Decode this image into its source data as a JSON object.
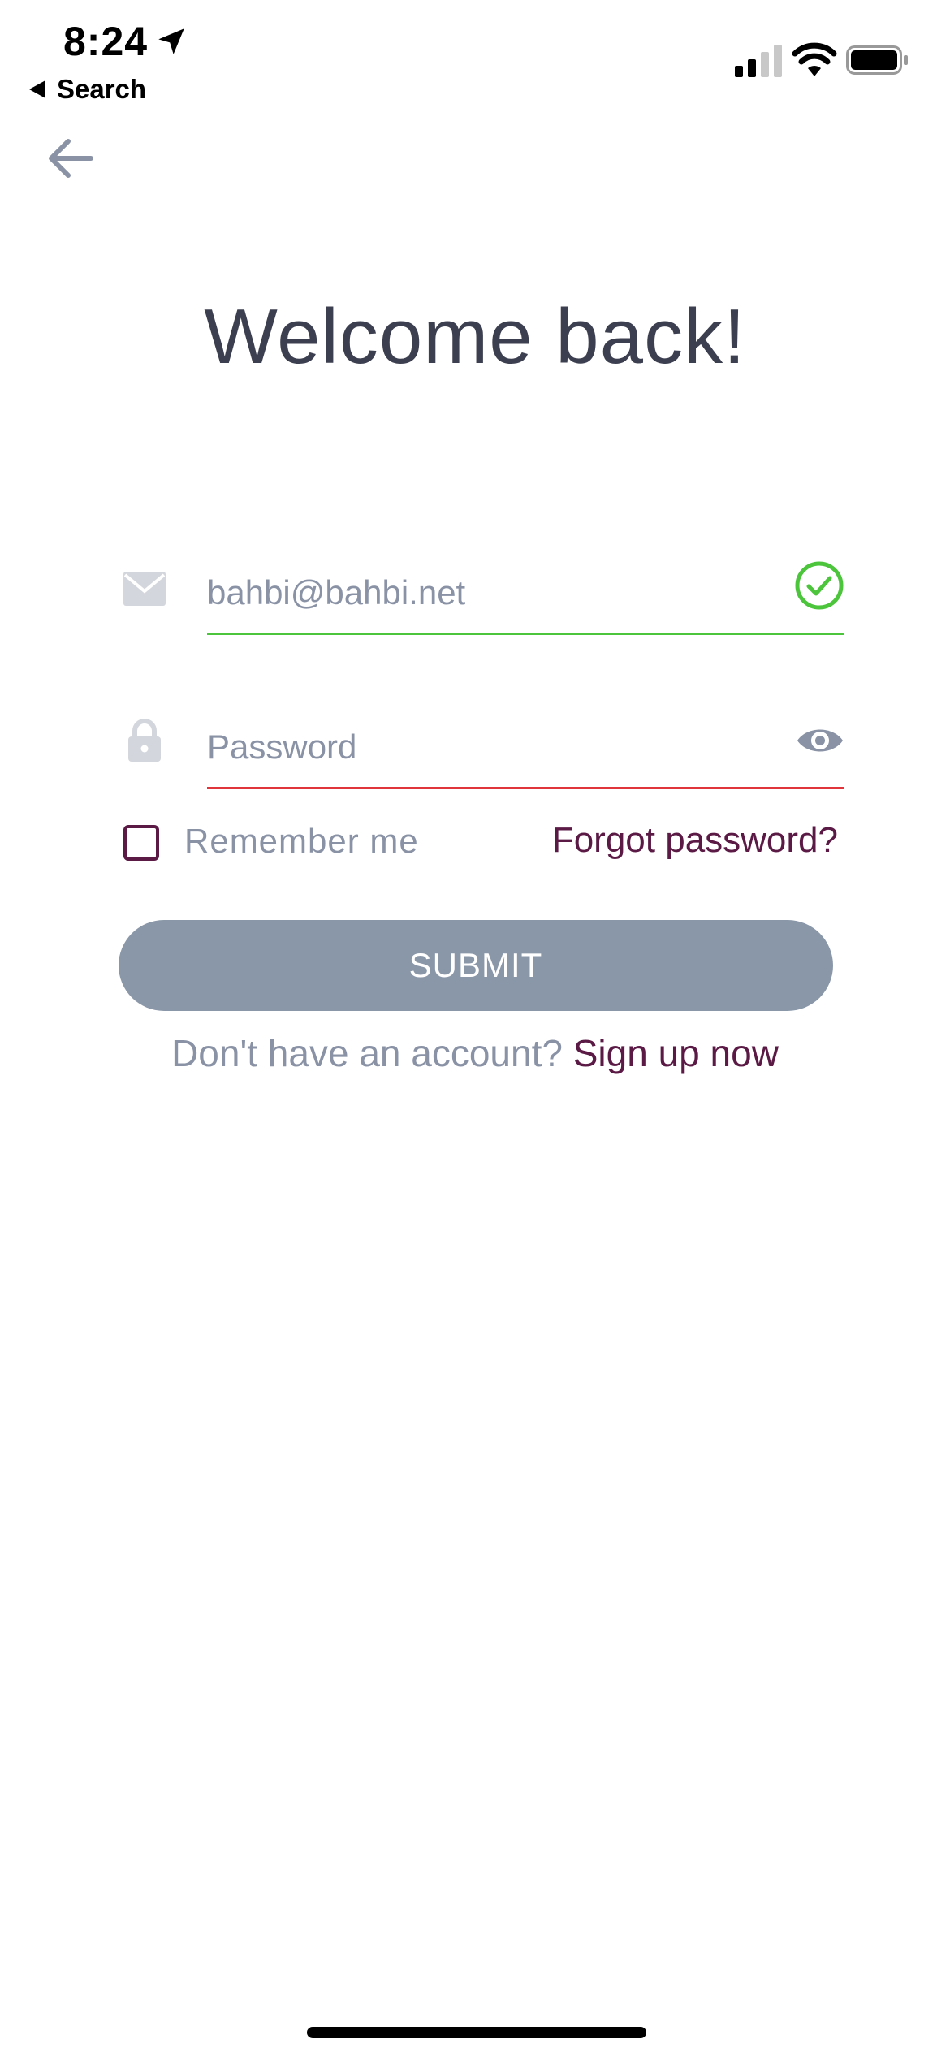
{
  "status_bar": {
    "time": "8:24",
    "back_label": "Search",
    "icons": [
      "location-arrow-icon",
      "cellular-signal-icon",
      "wifi-icon",
      "battery-icon"
    ]
  },
  "nav": {
    "back_icon": "arrow-left-icon"
  },
  "title": "Welcome back!",
  "email_field": {
    "value": "",
    "placeholder": "bahbi@bahbi.net",
    "leading_icon": "envelope-icon",
    "trailing_icon": "check-circle-icon",
    "status": "valid"
  },
  "password_field": {
    "value": "",
    "placeholder": "Password",
    "leading_icon": "lock-icon",
    "trailing_icon": "eye-icon",
    "status": "invalid"
  },
  "remember": {
    "label": "Remember me",
    "checked": false
  },
  "forgot_link": "Forgot password?",
  "submit_label": "SUBMIT",
  "signup": {
    "prompt": "Don't have an account?",
    "link": "Sign up now"
  },
  "colors": {
    "title": "#3c3f4f",
    "accent": "#5a1a45",
    "muted_text": "#8a93a6",
    "button": "#8a97a9",
    "valid": "#4cc43c",
    "invalid": "#e0353a"
  }
}
